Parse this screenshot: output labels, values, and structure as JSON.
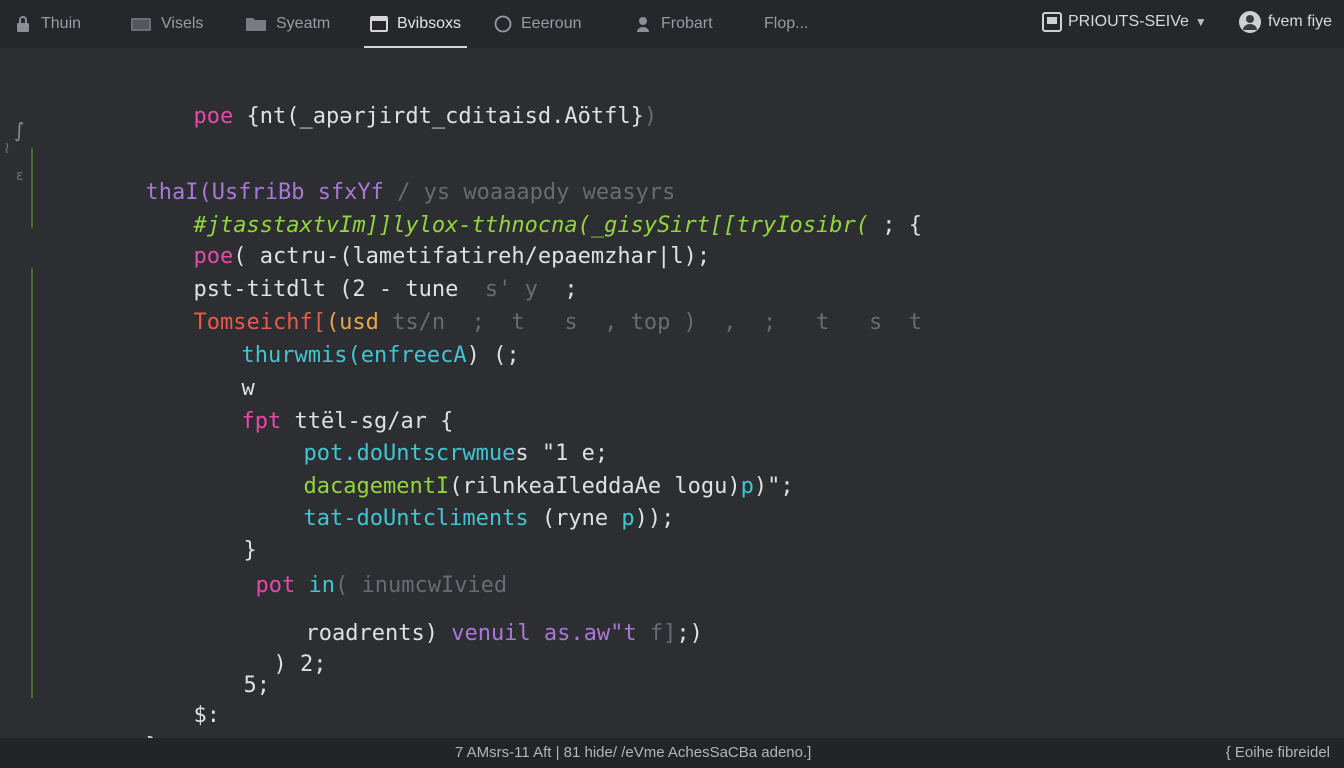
{
  "tabs": [
    {
      "label": "Thuin"
    },
    {
      "label": "Visels"
    },
    {
      "label": "Syeatm"
    },
    {
      "label": "Bvibsoxs"
    },
    {
      "label": "Eeeroun"
    },
    {
      "label": "Frobart"
    },
    {
      "label": "Flop..."
    }
  ],
  "topright": {
    "server_label": "PRIOUTS-SEIVe",
    "user_label": "fvem fiye"
  },
  "code": {
    "l1": [
      "poe",
      " {nt(_apərjirdt_cditaisd.Aötfl",
      "}",
      ")"
    ],
    "l2": [
      "thaI(",
      "UsfriBb ",
      "sfxYf",
      " / ys woaaapdy weasyrs"
    ],
    "l3": [
      "#jtasstaxtvIm]]lylox-tthnocna(_gisySirt[[tryIosibr(",
      " ; {"
    ],
    "l4": [
      "poe",
      "( actru-(lametifatireh/epaemzhar|l);"
    ],
    "l5": [
      "pst-titdlt (2 - tune",
      "  s' y",
      "  ;"
    ],
    "l6": [
      "Tomseichf[",
      "(usd",
      " ts/n  ;  t   s  , top )  ,  ;   t   s  t"
    ],
    "l7": [
      "thurwmis(",
      "enfreecA",
      ") (;"
    ],
    "l8": [
      "w"
    ],
    "l9": [
      "fpt",
      " ttël-sg/ar {"
    ],
    "l10": [
      "pot.doUntscrwmue",
      "s \"1 e;"
    ],
    "l11": [
      "dacagementI",
      "(rilnkeaIleddaAe logu)",
      "p",
      ")\";"
    ],
    "l12": [
      "tat-doUntcliments",
      " (ryne ",
      "p",
      "));"
    ],
    "l13": [
      "}"
    ],
    "l14": [
      "pot",
      " in",
      "( inumcwIvied"
    ],
    "l15": [
      "roadrent",
      "s) ",
      "venuil as.aw\"t",
      " f]",
      ";)"
    ],
    "l16": [
      ") 2;"
    ],
    "l17": [
      "5;"
    ],
    "l18": [
      "$:"
    ],
    "l19": [
      "};"
    ]
  },
  "gutter": [
    "∫",
    "≀",
    "ε"
  ],
  "status": {
    "center": "7 AMsrs-11 Aft | 81 hide/ /eVme AchesSaCBa adeno.]",
    "right": "{ Eoihe fibreidel"
  }
}
